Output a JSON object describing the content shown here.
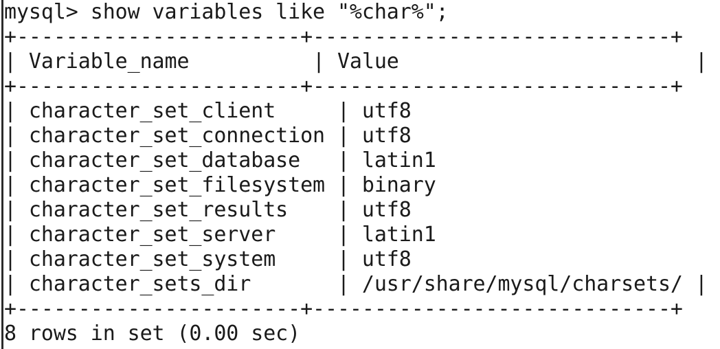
{
  "terminal": {
    "command_line": "mysql> show variables like \"%char%\";",
    "separator": "+-----------------------+-----------------------------+",
    "header": "| Variable_name          | Value                        |",
    "rows": [
      "| character_set_client     | utf8                         |",
      "| character_set_connection | utf8                         |",
      "| character_set_database   | latin1                       |",
      "| character_set_filesystem | binary                       |",
      "| character_set_results    | utf8                         |",
      "| character_set_server     | latin1                       |",
      "| character_set_system     | utf8                         |",
      "| character_sets_dir       | /usr/share/mysql/charsets/ |"
    ],
    "footer": "8 rows in set (0.00 sec)"
  }
}
